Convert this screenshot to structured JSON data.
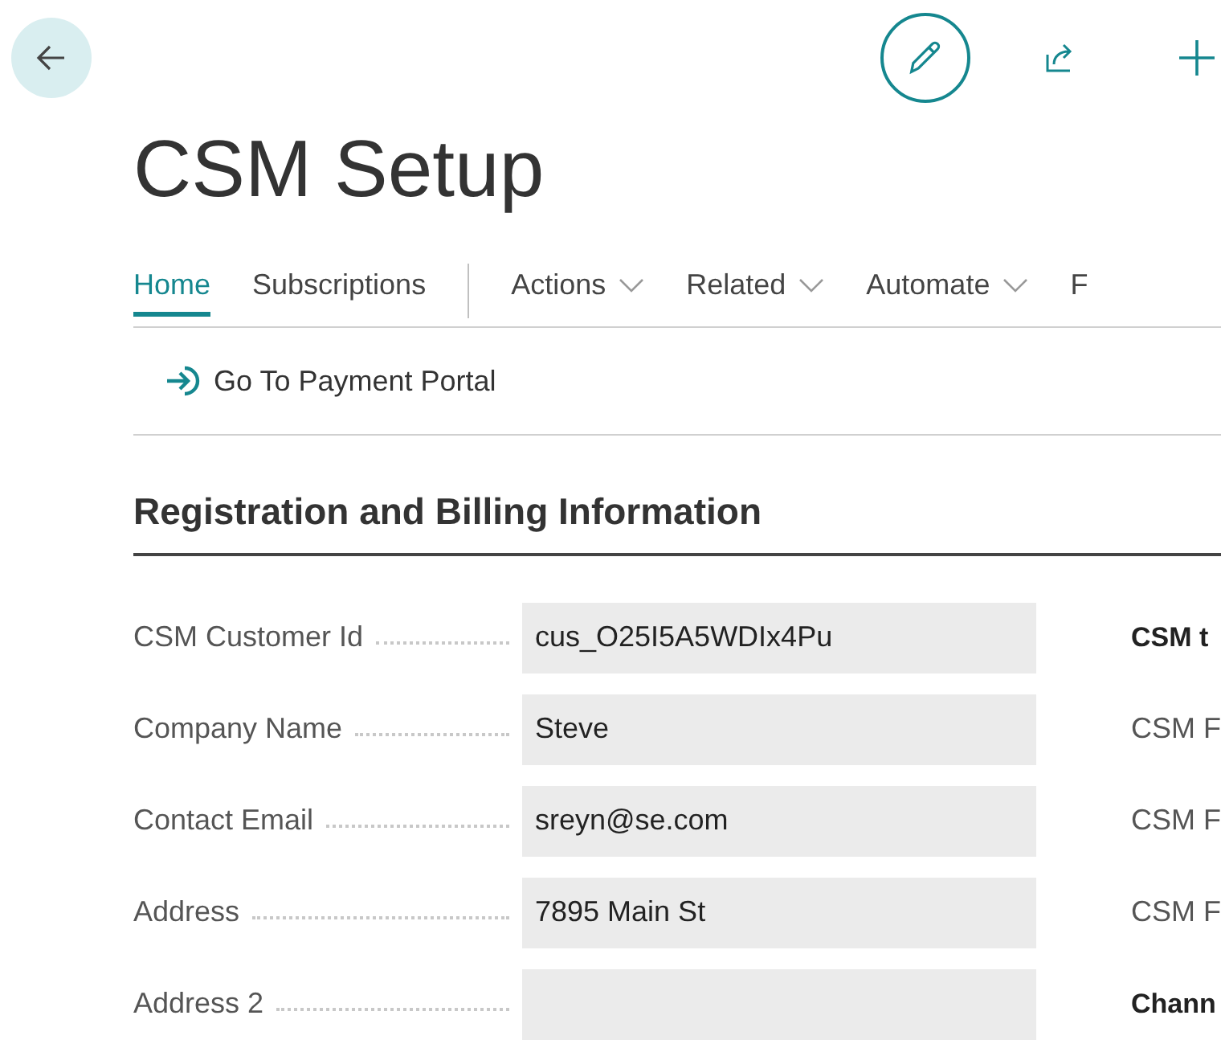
{
  "title": "CSM Setup",
  "tabs": [
    {
      "label": "Home",
      "selected": true,
      "kind": "tab"
    },
    {
      "label": "Subscriptions",
      "selected": false,
      "kind": "tab"
    },
    {
      "label": "Actions",
      "selected": false,
      "kind": "menu"
    },
    {
      "label": "Related",
      "selected": false,
      "kind": "menu"
    },
    {
      "label": "Automate",
      "selected": false,
      "kind": "menu"
    },
    {
      "label": "F",
      "selected": false,
      "kind": "tab"
    }
  ],
  "actions": [
    "Go To Payment Portal"
  ],
  "section": {
    "title": "Registration and Billing Information",
    "fields": [
      {
        "label": "CSM Customer Id",
        "value": "cus_O25I5A5WDIx4Pu"
      },
      {
        "label": "Company Name",
        "value": "Steve"
      },
      {
        "label": "Contact Email",
        "value": "sreyn@se.com"
      },
      {
        "label": "Address",
        "value": "7895 Main St"
      },
      {
        "label": "Address 2"
      }
    ],
    "right_column": [
      {
        "text": "CSM t",
        "kind": "heading"
      },
      {
        "text": "CSM F",
        "kind": "label"
      },
      {
        "text": "CSM F",
        "kind": "label"
      },
      {
        "text": "CSM F",
        "kind": "label"
      },
      {
        "text": "Chann",
        "kind": "heading"
      }
    ]
  }
}
